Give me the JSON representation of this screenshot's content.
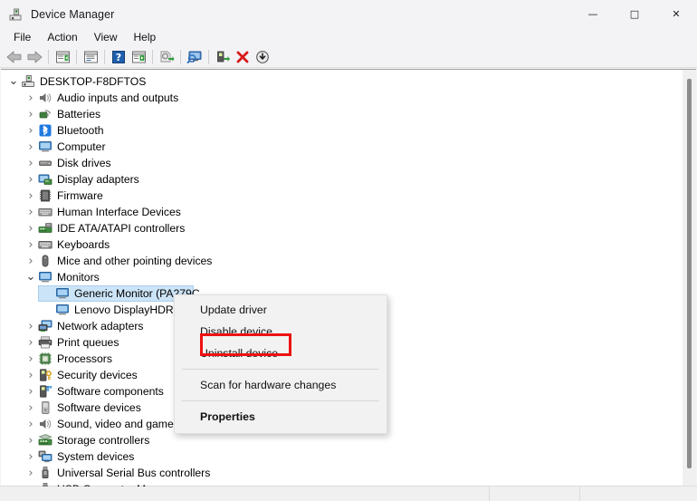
{
  "window": {
    "title": "Device Manager",
    "icon": "device-manager-icon",
    "controls": {
      "minimize": "—",
      "maximize": "□",
      "close": "✕"
    }
  },
  "menubar": {
    "items": [
      {
        "label": "File"
      },
      {
        "label": "Action"
      },
      {
        "label": "View"
      },
      {
        "label": "Help"
      }
    ]
  },
  "toolbar": {
    "buttons": [
      {
        "name": "back-arrow-icon",
        "kind": "back"
      },
      {
        "name": "forward-arrow-icon",
        "kind": "forward"
      },
      {
        "name": "separator",
        "kind": "sep"
      },
      {
        "name": "show-hidden-devices-icon",
        "kind": "window-left"
      },
      {
        "name": "separator",
        "kind": "sep"
      },
      {
        "name": "properties-icon",
        "kind": "window-props"
      },
      {
        "name": "separator",
        "kind": "sep"
      },
      {
        "name": "help-icon",
        "kind": "help"
      },
      {
        "name": "view-devices-icon",
        "kind": "window-play"
      },
      {
        "name": "separator",
        "kind": "sep"
      },
      {
        "name": "update-driver-icon",
        "kind": "update-driver"
      },
      {
        "name": "separator",
        "kind": "sep"
      },
      {
        "name": "scan-hardware-changes-icon",
        "kind": "scan"
      },
      {
        "name": "separator",
        "kind": "sep"
      },
      {
        "name": "enable-device-icon",
        "kind": "enable"
      },
      {
        "name": "uninstall-device-icon",
        "kind": "uninstall"
      },
      {
        "name": "disable-device-icon",
        "kind": "disable"
      }
    ]
  },
  "tree": {
    "root": {
      "label": "DESKTOP-F8DFTOS",
      "icon": "computer-root-icon",
      "expanded": true
    },
    "items": [
      {
        "label": "Audio inputs and outputs",
        "icon": "speaker-icon",
        "depth": 1,
        "expanded": false
      },
      {
        "label": "Batteries",
        "icon": "battery-icon",
        "depth": 1,
        "expanded": false
      },
      {
        "label": "Bluetooth",
        "icon": "bluetooth-icon",
        "depth": 1,
        "expanded": false
      },
      {
        "label": "Computer",
        "icon": "monitor-icon",
        "depth": 1,
        "expanded": false
      },
      {
        "label": "Disk drives",
        "icon": "disk-drive-icon",
        "depth": 1,
        "expanded": false
      },
      {
        "label": "Display adapters",
        "icon": "display-adapter-icon",
        "depth": 1,
        "expanded": false
      },
      {
        "label": "Firmware",
        "icon": "chip-icon",
        "depth": 1,
        "expanded": false
      },
      {
        "label": "Human Interface Devices",
        "icon": "hid-icon",
        "depth": 1,
        "expanded": false
      },
      {
        "label": "IDE ATA/ATAPI controllers",
        "icon": "ide-controller-icon",
        "depth": 1,
        "expanded": false
      },
      {
        "label": "Keyboards",
        "icon": "keyboard-icon",
        "depth": 1,
        "expanded": false
      },
      {
        "label": "Mice and other pointing devices",
        "icon": "mouse-icon",
        "depth": 1,
        "expanded": false
      },
      {
        "label": "Monitors",
        "icon": "monitor-icon",
        "depth": 1,
        "expanded": true
      },
      {
        "label": "Generic Monitor (PA279C",
        "icon": "monitor-icon",
        "depth": 2,
        "leaf": true,
        "selected": true
      },
      {
        "label": "Lenovo DisplayHDR",
        "icon": "monitor-icon",
        "depth": 2,
        "leaf": true
      },
      {
        "label": "Network adapters",
        "icon": "network-adapter-icon",
        "depth": 1,
        "expanded": false
      },
      {
        "label": "Print queues",
        "icon": "printer-icon",
        "depth": 1,
        "expanded": false
      },
      {
        "label": "Processors",
        "icon": "processor-icon",
        "depth": 1,
        "expanded": false
      },
      {
        "label": "Security devices",
        "icon": "security-device-icon",
        "depth": 1,
        "expanded": false
      },
      {
        "label": "Software components",
        "icon": "software-component-icon",
        "depth": 1,
        "expanded": false
      },
      {
        "label": "Software devices",
        "icon": "software-device-icon",
        "depth": 1,
        "expanded": false
      },
      {
        "label": "Sound, video and game controllers",
        "icon": "speaker-icon",
        "depth": 1,
        "expanded": false
      },
      {
        "label": "Storage controllers",
        "icon": "storage-controller-icon",
        "depth": 1,
        "expanded": false
      },
      {
        "label": "System devices",
        "icon": "system-device-icon",
        "depth": 1,
        "expanded": false
      },
      {
        "label": "Universal Serial Bus controllers",
        "icon": "usb-icon",
        "depth": 1,
        "expanded": false
      },
      {
        "label": "USB Connector Managers",
        "icon": "usb-icon",
        "depth": 1,
        "expanded": false
      }
    ]
  },
  "context_menu": {
    "items": [
      {
        "label": "Update driver",
        "type": "item"
      },
      {
        "label": "Disable device",
        "type": "item"
      },
      {
        "label": "Uninstall device",
        "type": "item",
        "highlighted": true
      },
      {
        "type": "separator"
      },
      {
        "label": "Scan for hardware changes",
        "type": "item"
      },
      {
        "type": "separator"
      },
      {
        "label": "Properties",
        "type": "item",
        "bold": true
      }
    ]
  },
  "statusbar": {
    "segments": [
      "",
      "",
      ""
    ]
  },
  "colors": {
    "selection": "#cce4f7",
    "highlight_box": "#ee1111",
    "titlebar": "#f3f3f5",
    "accent_blue": "#0078d4"
  }
}
